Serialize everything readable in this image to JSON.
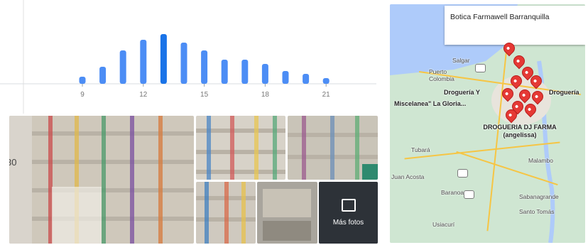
{
  "popular_times": {
    "hour_labels": [
      "9",
      "12",
      "15",
      "18",
      "21"
    ],
    "bar_levels": [
      0.1,
      0.24,
      0.47,
      0.62,
      0.7,
      0.58,
      0.47,
      0.34,
      0.34,
      0.28,
      0.18,
      0.14,
      0.08
    ],
    "highlight_index": 4,
    "colors": {
      "bar": "#4c8df5",
      "highlight": "#1a73e8",
      "tick": "#777777"
    }
  },
  "photos": {
    "cut_text": "30",
    "more_label": "Más fotos",
    "more_icon": "photo-library-icon"
  },
  "map": {
    "callout_title": "Botica Farmawell Barranquilla",
    "place_labels": [
      "Salgar",
      "Puerto Colombia",
      "Droguería Y",
      "Miscelanea\" La Gloria...",
      "Droguería",
      "DROGUERIA DJ FARMA (angelissa)",
      "Tubará",
      "Malambo",
      "Juan Acosta",
      "Baranoa",
      "Sabanagrande",
      "Santo Tomás",
      "Usiacurí"
    ],
    "pin_color": "#e53935"
  }
}
